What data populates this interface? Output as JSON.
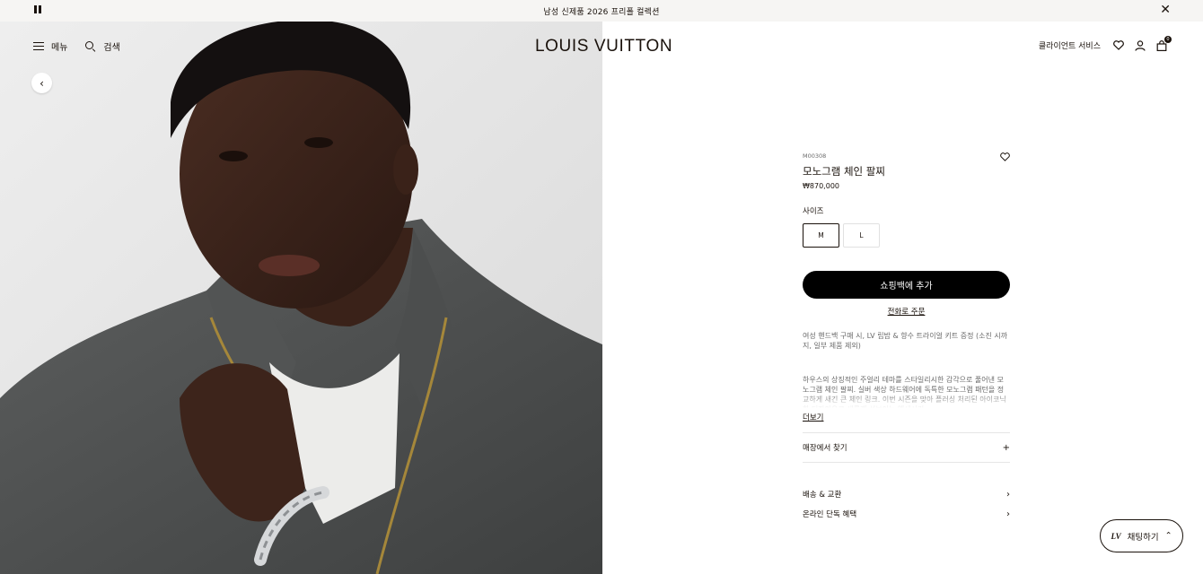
{
  "announcement": "남성 신제품 2026 프리폴 컬렉션",
  "header": {
    "menu_label": "메뉴",
    "search_label": "검색",
    "logo": "LOUIS VUITTON",
    "client_service": "클라이언트 서비스",
    "bag_count": "0"
  },
  "product": {
    "sku": "M00308",
    "name": "모노그램 체인 팔찌",
    "price": "₩870,000",
    "size_label": "사이즈",
    "sizes": [
      "M",
      "L"
    ],
    "selected_size": "M",
    "add_to_bag": "쇼핑백에 추가",
    "order_by_phone": "전화로 주문",
    "promo": "여성 핸드백 구매 시, LV 립밤 & 향수 트라이얼 키트 증정 (소진 시까지, 일부 제품 제외)",
    "description": "하우스의 상징적인 주얼리 테마를 스타일리시한 감각으로 풀어낸 모노그램 체인 팔찌. 실버 색상 하드웨어에 독특한 모노그램 패턴을 정교하게 새긴 큰 체인 링크. 이번 시즌을 맞아 플러싱 처리된 아이코닉한 디자인으로 새롭게 선보이는 액세서리.",
    "read_more": "더보기",
    "find_in_store": "매장에서 찾기",
    "links": [
      "배송 & 교환",
      "온라인 단독 혜택"
    ]
  },
  "chat": {
    "label": "채팅하기"
  }
}
